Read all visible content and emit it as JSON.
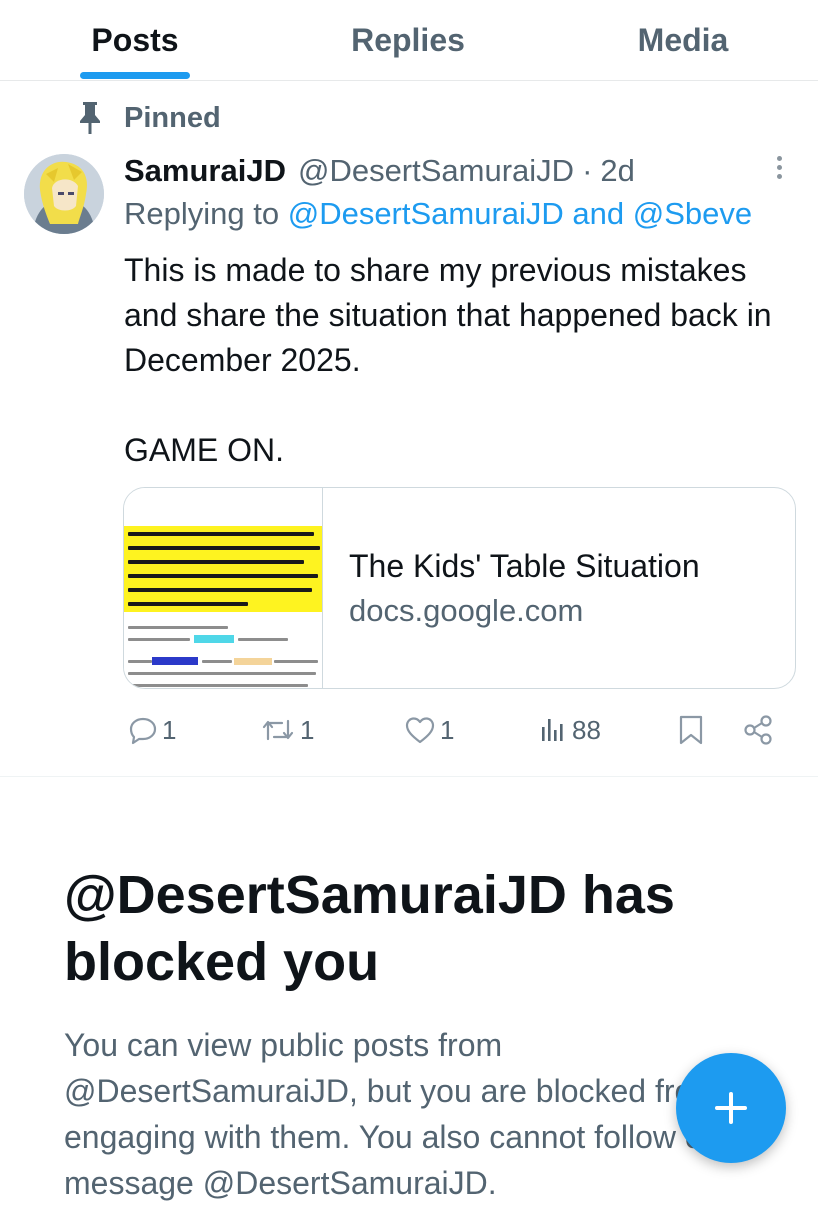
{
  "tabs": [
    {
      "label": "Posts",
      "active": true
    },
    {
      "label": "Replies",
      "active": false
    },
    {
      "label": "Media",
      "active": false
    }
  ],
  "pinned_label": "Pinned",
  "post": {
    "display_name": "SamuraiJD",
    "handle": "@DesertSamuraiJD",
    "separator": "·",
    "time": "2d",
    "replying_prefix": "Replying to",
    "replying_link": "@DesertSamuraiJD and @Sbeve",
    "text": "This is made to share my previous mistakes and share the situation that happened back in December 2025.\n\nGAME ON.",
    "card": {
      "title": "The Kids' Table Situation",
      "domain": "docs.google.com"
    },
    "stats": {
      "replies": "1",
      "reposts": "1",
      "likes": "1",
      "views": "88"
    }
  },
  "blocked": {
    "title": "@DesertSamuraiJD has blocked you",
    "body": "You can view public posts from @DesertSamuraiJD, but you are blocked from engaging with them. You also cannot follow or message @DesertSamuraiJD."
  },
  "colors": {
    "accent": "#1d9bf0",
    "muted": "#536471",
    "text": "#0f1419"
  },
  "icons": [
    "pin-icon",
    "more-icon",
    "reply-icon",
    "repost-icon",
    "like-icon",
    "views-icon",
    "bookmark-icon",
    "share-icon",
    "plus-icon"
  ]
}
